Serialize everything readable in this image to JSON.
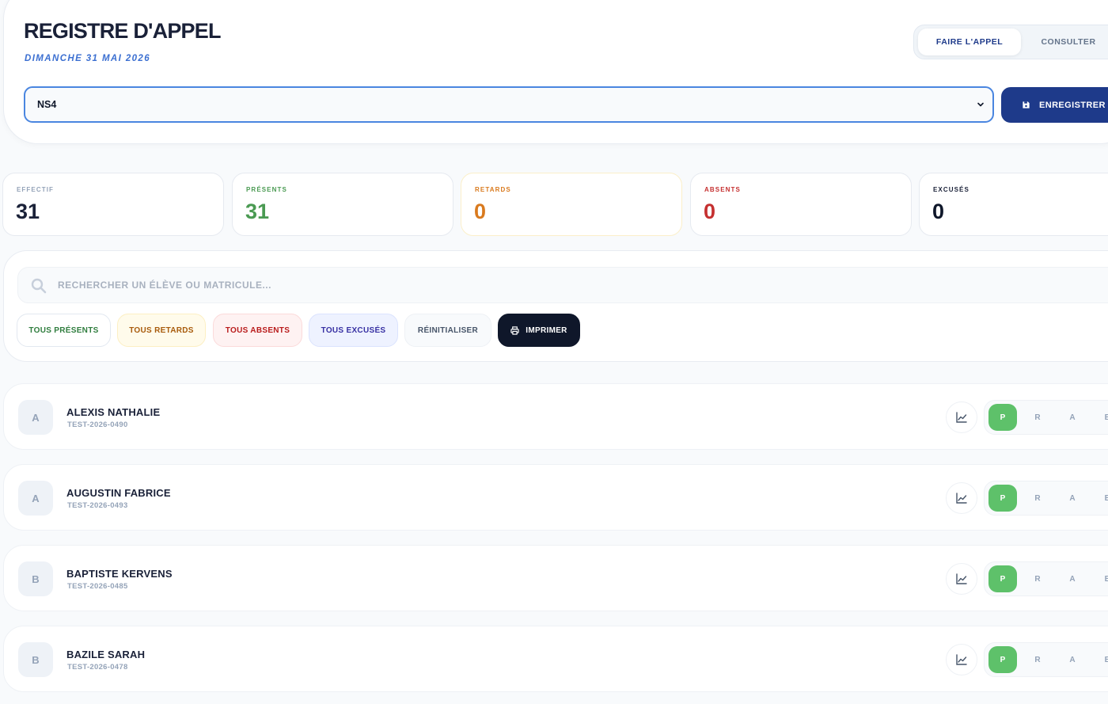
{
  "header": {
    "title": "REGISTRE D'APPEL",
    "date": "DIMANCHE 31 MAI 2026",
    "mode_tabs": [
      {
        "label": "FAIRE L'APPEL",
        "active": true
      },
      {
        "label": "CONSULTER",
        "active": false
      }
    ],
    "class_select": {
      "value": "NS4"
    },
    "save_label": "ENREGISTRER",
    "accent_color": "#1e3a8a"
  },
  "stats": [
    {
      "label": "EFFECTIF",
      "value": "31",
      "color": "#1a2138",
      "label_color": "#94a3b8"
    },
    {
      "label": "PRÉSENTS",
      "value": "31",
      "color": "#4a9a52",
      "label_color": "#4a9a52"
    },
    {
      "label": "RETARDS",
      "value": "0",
      "color": "#d97a1e",
      "label_color": "#d97a1e"
    },
    {
      "label": "ABSENTS",
      "value": "0",
      "color": "#c53030",
      "label_color": "#c53030"
    },
    {
      "label": "EXCUSÉS",
      "value": "0",
      "color": "#0f172a",
      "label_color": "#1a2138"
    }
  ],
  "search": {
    "placeholder": "RECHERCHER UN ÉLÈVE OU MATRICULE...",
    "value": ""
  },
  "bulk_actions": {
    "all_present": "TOUS PRÉSENTS",
    "all_late": "TOUS RETARDS",
    "all_absent": "TOUS ABSENTS",
    "all_excused": "TOUS EXCUSÉS",
    "reset": "RÉINITIALISER",
    "print": "IMPRIMER"
  },
  "status_codes": {
    "present": "P",
    "late": "R",
    "absent": "A",
    "excused": "E"
  },
  "status_colors": {
    "present_selected": "#5ec16a"
  },
  "students": [
    {
      "initial": "A",
      "name": "ALEXIS NATHALIE",
      "id": "TEST-2026-0490",
      "status": "present"
    },
    {
      "initial": "A",
      "name": "AUGUSTIN FABRICE",
      "id": "TEST-2026-0493",
      "status": "present"
    },
    {
      "initial": "B",
      "name": "BAPTISTE KERVENS",
      "id": "TEST-2026-0485",
      "status": "present"
    },
    {
      "initial": "B",
      "name": "BAZILE SARAH",
      "id": "TEST-2026-0478",
      "status": "present"
    }
  ]
}
